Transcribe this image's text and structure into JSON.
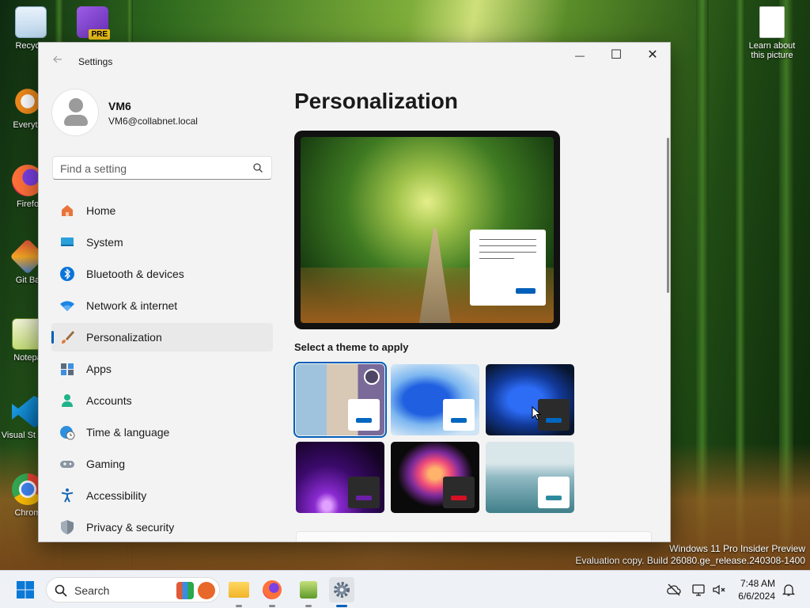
{
  "desktop": {
    "icons": [
      {
        "label": "Recycle",
        "icon": "recycle-bin-icon"
      },
      {
        "label": "PRE",
        "icon": "visual-studio-preview-icon"
      },
      {
        "label": "Everyth",
        "icon": "everything-search-icon"
      },
      {
        "label": "Firefo",
        "icon": "firefox-icon"
      },
      {
        "label": "Git Ba",
        "icon": "git-bash-icon"
      },
      {
        "label": "Notepa",
        "icon": "notepad-plus-plus-icon"
      },
      {
        "label": "Visual St Cod",
        "icon": "vscode-icon"
      },
      {
        "label": "Chrom",
        "icon": "chrome-icon"
      },
      {
        "label": "Learn about this picture",
        "icon": "document-icon"
      }
    ],
    "watermark_line1": "Windows 11 Pro Insider Preview",
    "watermark_line2": "Evaluation copy. Build 26080.ge_release.240308-1400"
  },
  "window": {
    "title": "Settings",
    "back_icon": "back-arrow-icon",
    "controls": {
      "minimize": "—",
      "maximize": "☐",
      "close": "✕"
    }
  },
  "profile": {
    "name": "VM6",
    "email": "VM6@collabnet.local"
  },
  "search": {
    "placeholder": "Find a setting",
    "value": ""
  },
  "nav": {
    "items": [
      {
        "label": "Home",
        "icon": "home-icon"
      },
      {
        "label": "System",
        "icon": "system-display-icon"
      },
      {
        "label": "Bluetooth & devices",
        "icon": "bluetooth-icon"
      },
      {
        "label": "Network & internet",
        "icon": "wifi-icon"
      },
      {
        "label": "Personalization",
        "icon": "paintbrush-icon",
        "active": true
      },
      {
        "label": "Apps",
        "icon": "apps-icon"
      },
      {
        "label": "Accounts",
        "icon": "accounts-icon"
      },
      {
        "label": "Time & language",
        "icon": "globe-clock-icon"
      },
      {
        "label": "Gaming",
        "icon": "gamepad-icon"
      },
      {
        "label": "Accessibility",
        "icon": "accessibility-icon"
      },
      {
        "label": "Privacy & security",
        "icon": "shield-icon"
      }
    ]
  },
  "main": {
    "title": "Personalization",
    "theme_heading": "Select a theme to apply",
    "themes": [
      {
        "name": "spotlight",
        "selected": true,
        "accent": "#0067c0"
      },
      {
        "name": "windows-light",
        "selected": false,
        "accent": "#0067c0"
      },
      {
        "name": "windows-dark",
        "selected": false,
        "accent": "#0067c0"
      },
      {
        "name": "glow",
        "selected": false,
        "accent": "#6b1fa8"
      },
      {
        "name": "captured-motion",
        "selected": false,
        "accent": "#d41124"
      },
      {
        "name": "sunrise",
        "selected": false,
        "accent": "#2d8a9e"
      }
    ]
  },
  "taskbar": {
    "search_label": "Search",
    "time": "7:48 AM",
    "date": "6/6/2024"
  },
  "colors": {
    "accent": "#005fb8",
    "window_bg": "#f3f3f3"
  }
}
